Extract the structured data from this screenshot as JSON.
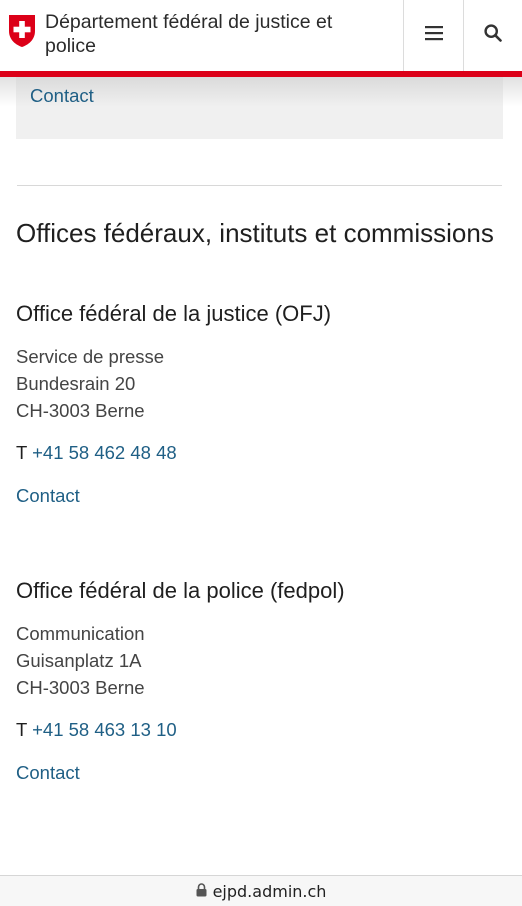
{
  "header": {
    "title": "Département fédéral de justice et police",
    "brand_color": "#dc0018",
    "menu_icon": "hamburger-menu-icon",
    "search_icon": "search-icon"
  },
  "top_card": {
    "contact_label": "Contact"
  },
  "section": {
    "heading": "Offices fédéraux, instituts et commissions"
  },
  "offices": [
    {
      "name": "Office fédéral de la justice (OFJ)",
      "address": [
        "Service de presse",
        "Bundesrain 20",
        "CH-3003 Berne"
      ],
      "phone_prefix": "T",
      "phone": "+41 58 462 48 48",
      "contact_label": "Contact"
    },
    {
      "name": "Office fédéral de la police (fedpol)",
      "address": [
        "Communication",
        "Guisanplatz 1A",
        "CH-3003 Berne"
      ],
      "phone_prefix": "T",
      "phone": "+41 58 463 13 10",
      "contact_label": "Contact"
    }
  ],
  "browser": {
    "url": "ejpd.admin.ch",
    "lock_icon": "lock-icon"
  },
  "colors": {
    "link": "#1f5f85",
    "accent_red": "#dc0018",
    "card_bg": "#f0f0f0"
  }
}
